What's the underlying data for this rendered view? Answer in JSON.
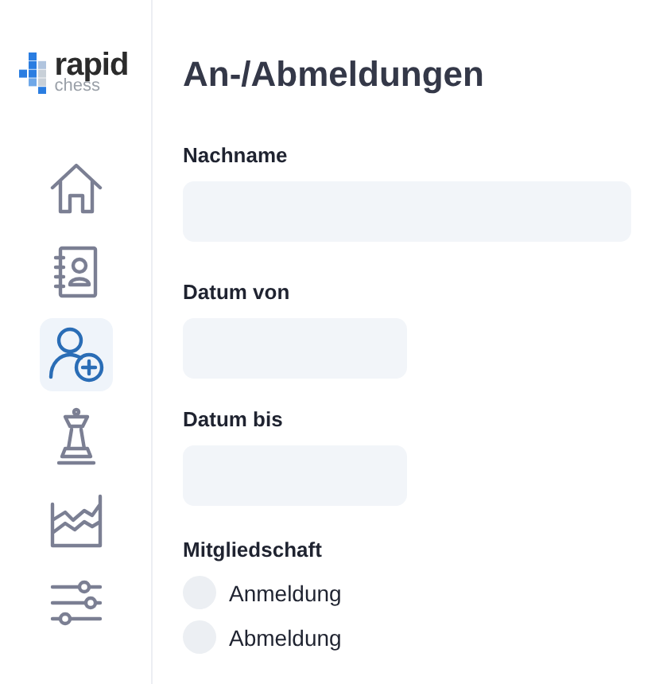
{
  "logo": {
    "name": "rapid",
    "sub": "chess"
  },
  "nav": [
    {
      "kind": "home",
      "selected": false
    },
    {
      "kind": "contacts",
      "selected": false
    },
    {
      "kind": "add-user",
      "selected": true
    },
    {
      "kind": "chess",
      "selected": false
    },
    {
      "kind": "chart",
      "selected": false
    },
    {
      "kind": "sliders",
      "selected": false
    }
  ],
  "title": "An-/Abmeldungen",
  "fields": [
    {
      "label": "Nachname",
      "kind": "text"
    },
    {
      "label": "Datum von",
      "kind": "date"
    },
    {
      "label": "Datum bis",
      "kind": "date"
    }
  ],
  "membership": {
    "label": "Mitgliedschaft",
    "options": [
      {
        "label": "Anmeldung",
        "selected": false
      },
      {
        "label": "Abmeldung",
        "selected": false
      }
    ]
  }
}
